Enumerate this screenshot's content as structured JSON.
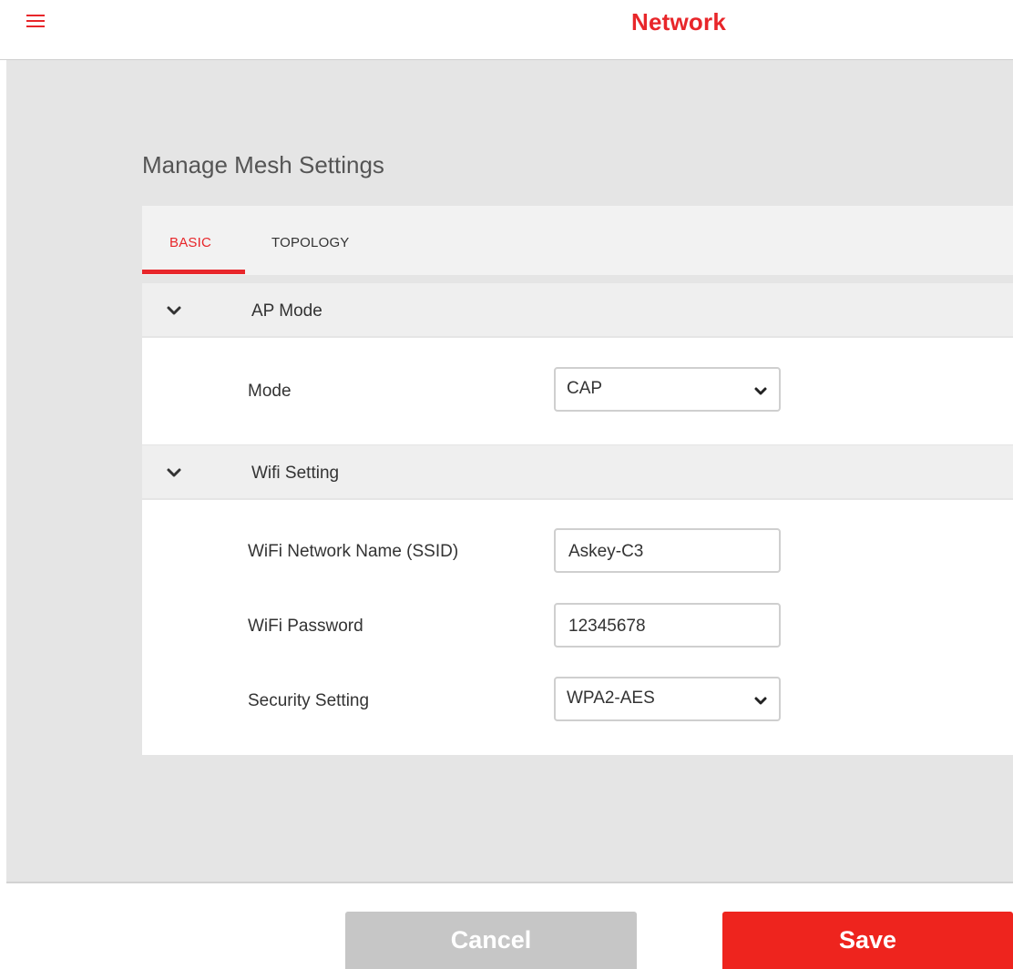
{
  "header": {
    "title": "Network",
    "menu_icon": "hamburger-menu-icon",
    "accent_color": "#e8262a"
  },
  "section": {
    "title": "Manage Mesh Settings"
  },
  "tabs": [
    {
      "label": "BASIC",
      "active": true
    },
    {
      "label": "TOPOLOGY",
      "active": false
    }
  ],
  "ap_mode": {
    "header": "AP Mode",
    "expanded": true,
    "mode_label": "Mode",
    "mode_value": "CAP"
  },
  "wifi": {
    "header": "Wifi Setting",
    "expanded": true,
    "ssid_label": "WiFi Network Name (SSID)",
    "ssid_value": "Askey-C3",
    "password_label": "WiFi Password",
    "password_value": "12345678",
    "security_label": "Security Setting",
    "security_value": "WPA2-AES"
  },
  "footer": {
    "cancel_label": "Cancel",
    "save_label": "Save",
    "save_color": "#ee241e"
  }
}
